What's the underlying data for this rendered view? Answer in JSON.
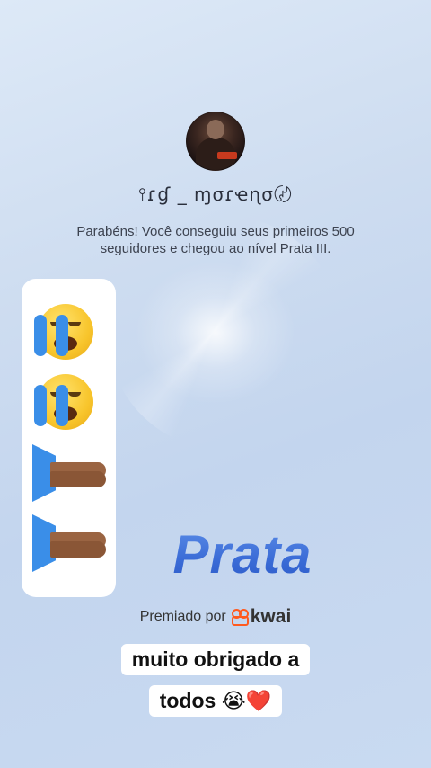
{
  "profile": {
    "avatar_icon": "profile-photo-icon",
    "username": "⫯ɾɠ _ ɱσɾҽɳσ〄"
  },
  "message": "Parabéns! Você conseguiu seus primeiros 500 seguidores e chegou ao nível Prata III.",
  "sticker": {
    "icons": [
      "loudly-crying-face-icon",
      "loudly-crying-face-icon",
      "folded-hands-icon",
      "folded-hands-icon"
    ]
  },
  "level": "Prata",
  "award": {
    "prefix": "Premiado por",
    "brand": "kwai",
    "brand_color": "#ff5a1f"
  },
  "caption": {
    "line1": "muito obrigado a",
    "line2": "todos 😭❤️"
  },
  "colors": {
    "level_text": "#3a6bd6",
    "tear_blue": "#3a8ee8"
  }
}
